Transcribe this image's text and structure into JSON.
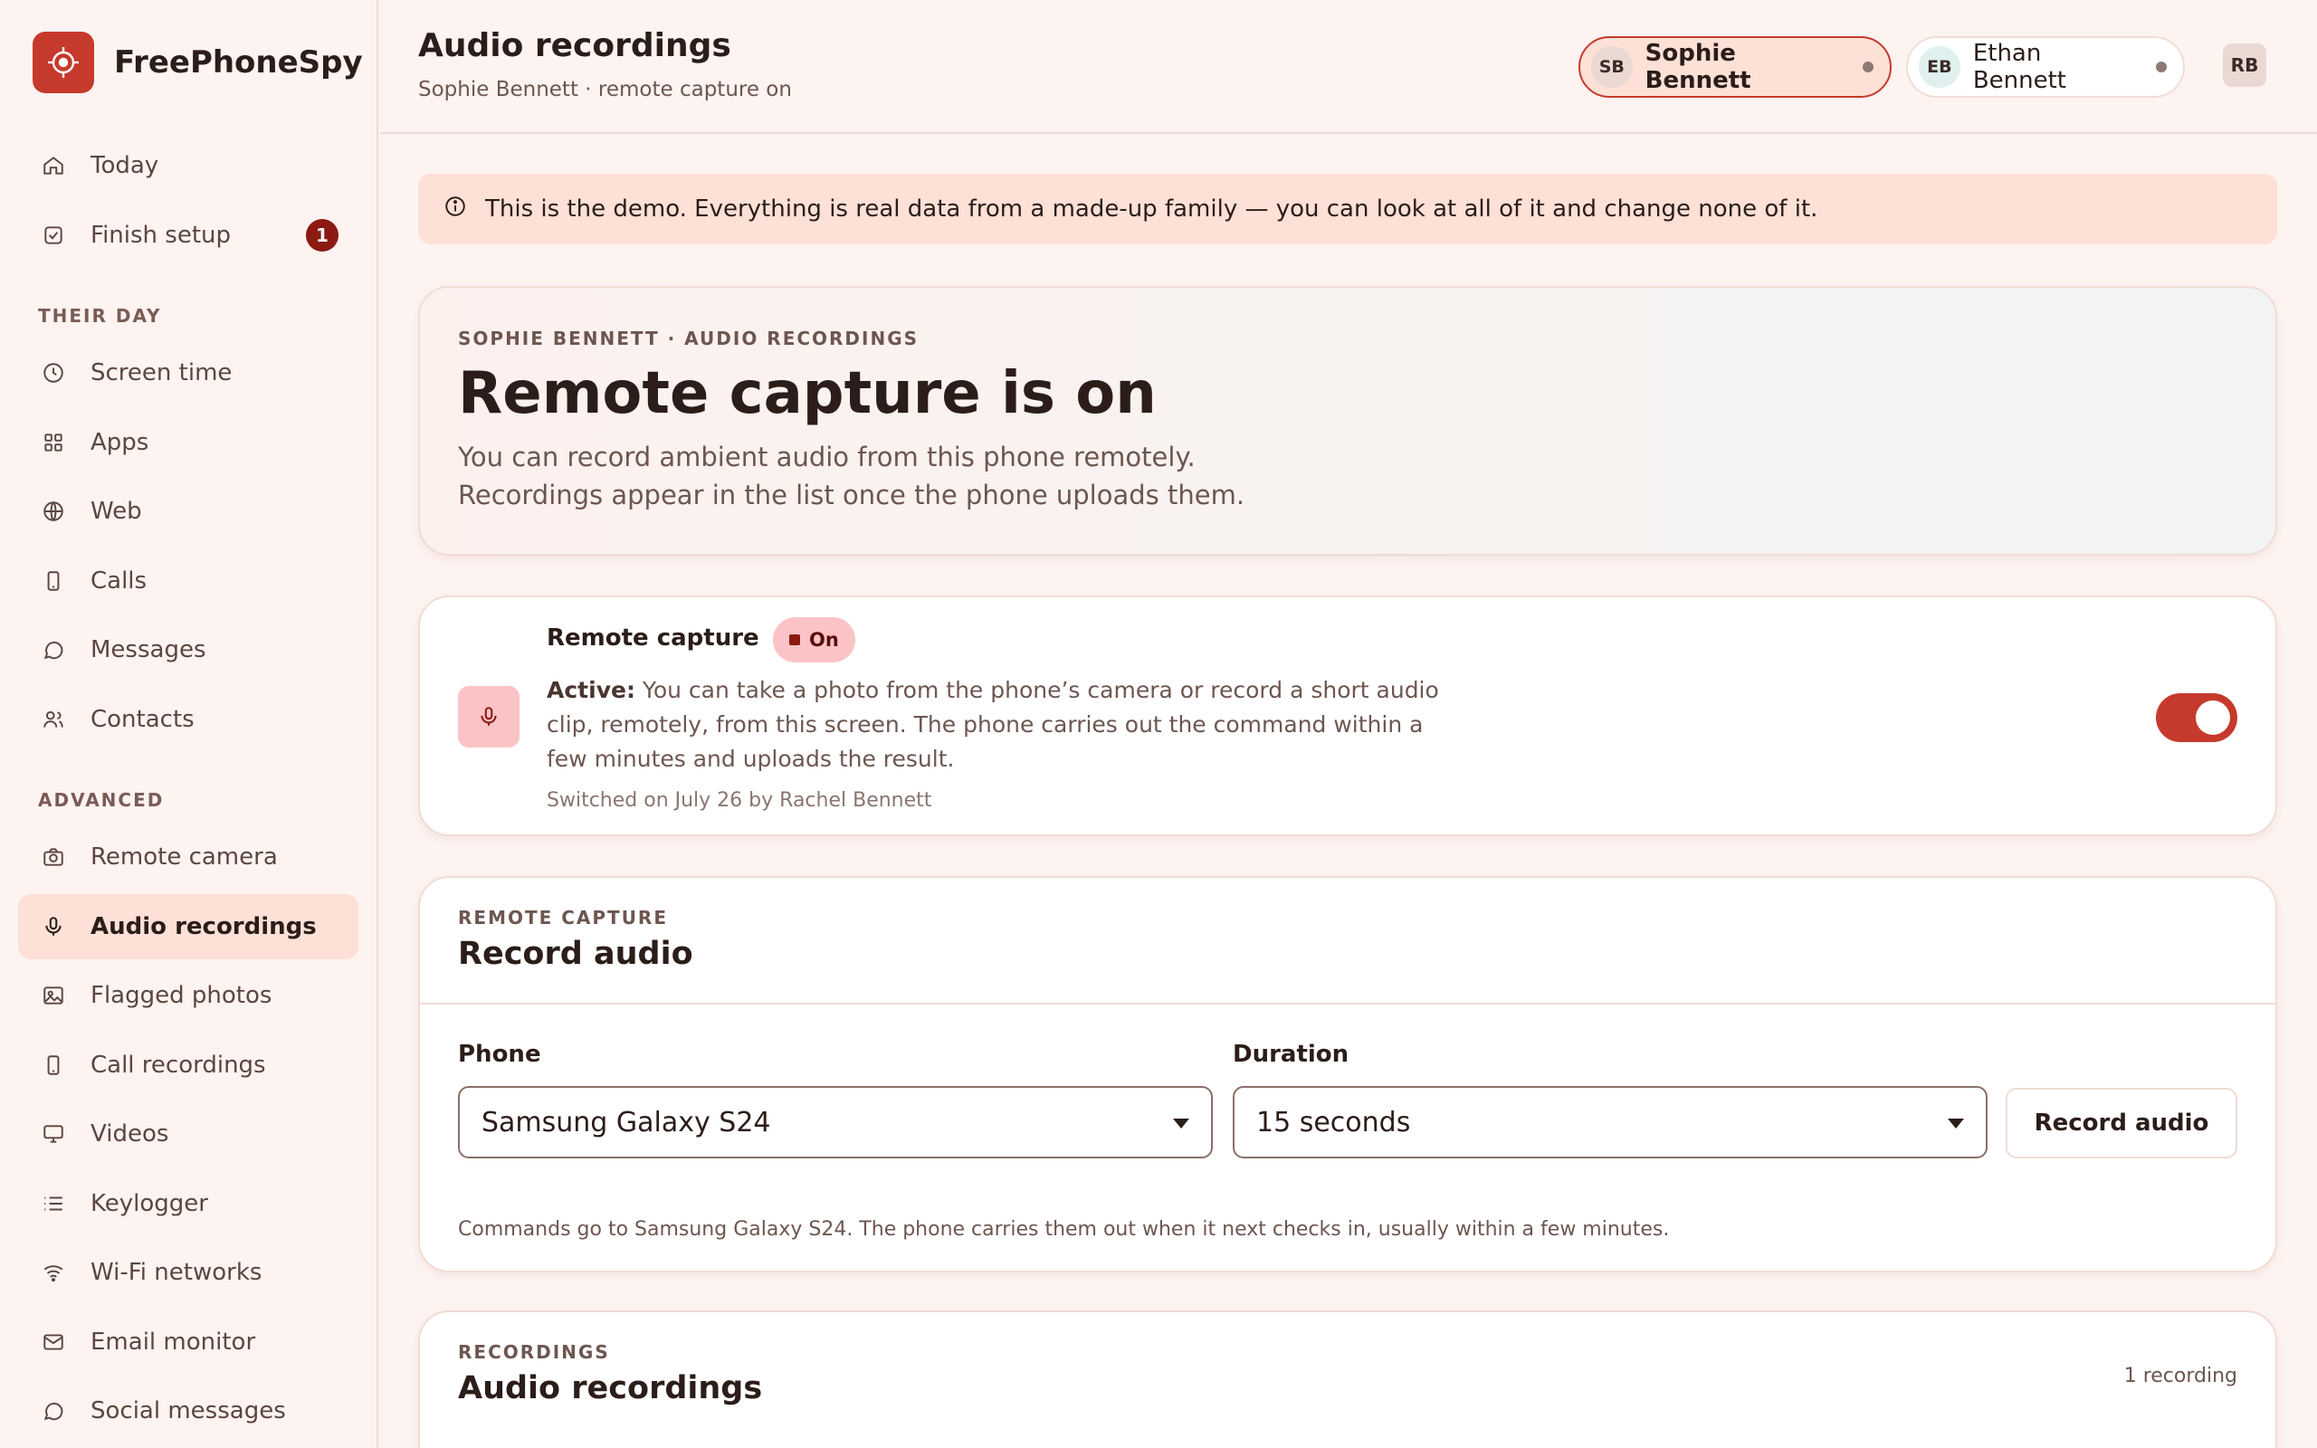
{
  "app": {
    "name": "FreePhoneSpy"
  },
  "sidebar": {
    "top_items": [
      {
        "label": "Today",
        "icon": "home-icon"
      },
      {
        "label": "Finish setup",
        "icon": "checkbox-icon",
        "badge": "1"
      }
    ],
    "section_day": "THEIR DAY",
    "day_items": [
      {
        "label": "Screen time",
        "icon": "clock-icon"
      },
      {
        "label": "Apps",
        "icon": "grid-icon"
      },
      {
        "label": "Web",
        "icon": "globe-icon"
      },
      {
        "label": "Calls",
        "icon": "phone-icon"
      },
      {
        "label": "Messages",
        "icon": "chat-icon"
      },
      {
        "label": "Contacts",
        "icon": "users-icon"
      }
    ],
    "section_advanced": "ADVANCED",
    "advanced_items": [
      {
        "label": "Remote camera",
        "icon": "camera-icon"
      },
      {
        "label": "Audio recordings",
        "icon": "mic-icon",
        "active": true
      },
      {
        "label": "Flagged photos",
        "icon": "image-icon"
      },
      {
        "label": "Call recordings",
        "icon": "phone-icon"
      },
      {
        "label": "Videos",
        "icon": "monitor-icon"
      },
      {
        "label": "Keylogger",
        "icon": "list-icon"
      },
      {
        "label": "Wi-Fi networks",
        "icon": "wifi-icon"
      },
      {
        "label": "Email monitor",
        "icon": "mail-icon"
      },
      {
        "label": "Social messages",
        "icon": "chat-icon"
      }
    ]
  },
  "header": {
    "title": "Audio recordings",
    "subtitle": "Sophie Bennett · remote capture on",
    "profiles": [
      {
        "initials": "SB",
        "name": "Sophie Bennett",
        "selected": true
      },
      {
        "initials": "EB",
        "name": "Ethan Bennett",
        "selected": false
      }
    ],
    "account_initials": "RB"
  },
  "banner": {
    "text": "This is the demo. Everything is real data from a made-up family — you can look at all of it and change none of it."
  },
  "hero": {
    "eyebrow": "SOPHIE BENNETT · AUDIO RECORDINGS",
    "title": "Remote capture is on",
    "line1": "You can record ambient audio from this phone remotely.",
    "line2": "Recordings appear in the list once the phone uploads them."
  },
  "status": {
    "title": "Remote capture",
    "badge": "On",
    "desc_strong": "Active:",
    "desc": "You can take a photo from the phone’s camera or record a short audio clip, remotely, from this screen. The phone carries out the command within a few minutes and uploads the result.",
    "meta": "Switched on July 26 by Rachel Bennett",
    "toggle_on": true
  },
  "record": {
    "eyebrow": "REMOTE CAPTURE",
    "title": "Record audio",
    "phone_label": "Phone",
    "phone_value": "Samsung Galaxy S24",
    "duration_label": "Duration",
    "duration_value": "15 seconds",
    "button": "Record audio",
    "hint": "Commands go to Samsung Galaxy S24. The phone carries them out when it next checks in, usually within a few minutes."
  },
  "recordings": {
    "eyebrow": "RECORDINGS",
    "title": "Audio recordings",
    "count": "1 recording"
  },
  "colors": {
    "accent": "#c53a2c",
    "badge": "#8b1a13",
    "banner": "#fde0d6",
    "active_nav": "#fde0d6"
  }
}
